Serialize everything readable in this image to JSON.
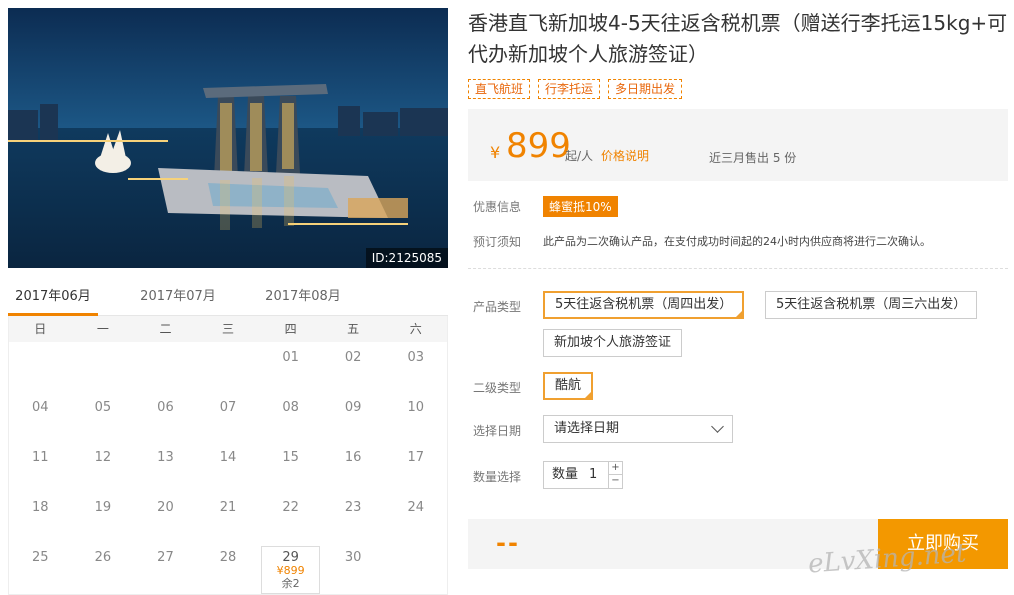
{
  "hero": {
    "id_label": "ID:2125085"
  },
  "months": [
    "2017年06月",
    "2017年07月",
    "2017年08月"
  ],
  "weekdays": [
    "日",
    "一",
    "二",
    "三",
    "四",
    "五",
    "六"
  ],
  "calendar": {
    "rows": [
      [
        "",
        "",
        "",
        "",
        "01",
        "02",
        "03"
      ],
      [
        "04",
        "05",
        "06",
        "07",
        "08",
        "09",
        "10"
      ],
      [
        "11",
        "12",
        "13",
        "14",
        "15",
        "16",
        "17"
      ],
      [
        "18",
        "19",
        "20",
        "21",
        "22",
        "23",
        "24"
      ],
      [
        "25",
        "26",
        "27",
        "28",
        "29",
        "30",
        ""
      ]
    ],
    "available": {
      "day": "29",
      "price": "¥899",
      "stock": "余2"
    }
  },
  "product": {
    "title": "香港直飞新加坡4-5天往返含税机票（赠送行李托运15kg+可代办新加坡个人旅游签证）",
    "tags": [
      "直飞航班",
      "行李托运",
      "多日期出发"
    ]
  },
  "price": {
    "currency": "¥",
    "amount": "899",
    "unit": "起/人",
    "explain_link": "价格说明",
    "sold": "近三月售出 5 份"
  },
  "info": {
    "discount_label": "优惠信息",
    "discount_badge": "蜂蜜抵10%",
    "notice_label": "预订须知",
    "notice_text": "此产品为二次确认产品，在支付成功时间起的24小时内供应商将进行二次确认。"
  },
  "options": {
    "product_type_label": "产品类型",
    "product_types": [
      "5天往返含税机票（周四出发）",
      "5天往返含税机票（周三六出发）",
      "新加坡个人旅游签证"
    ],
    "secondary_label": "二级类型",
    "secondary": "酷航",
    "date_label": "选择日期",
    "date_placeholder": "请选择日期",
    "qty_label": "数量选择",
    "qty_inner_label": "数量",
    "qty_value": "1",
    "plus": "+",
    "minus": "−"
  },
  "buy": {
    "total": "--",
    "button": "立即购买"
  },
  "watermark": "eLvXing.net"
}
